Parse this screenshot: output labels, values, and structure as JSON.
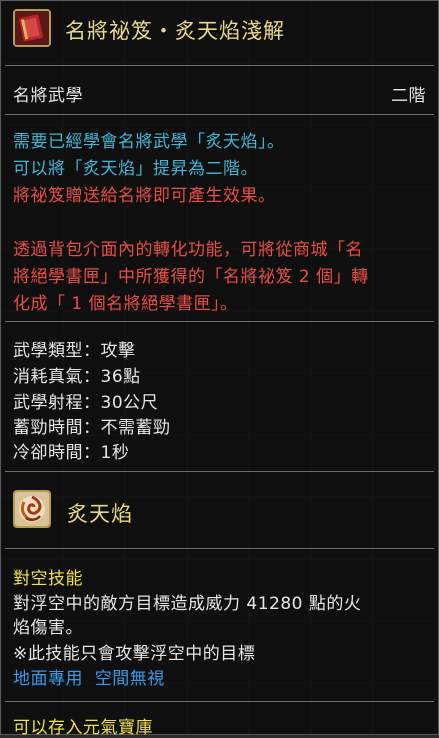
{
  "book": {
    "icon": "red-book-icon",
    "title": "名將祕笈・炙天焰淺解",
    "category": "名將武學",
    "grade": "二階",
    "desc_cyan": [
      "需要已經學會名將武學「炙天焰」。",
      "可以將「炙天焰」提昇為二階。"
    ],
    "desc_red": [
      "將祕笈贈送給名將即可產生效果。",
      "透過背包介面內的轉化功能，可將從商城「名",
      "將絕學書匣」中所獲得的「名將祕笈 2 個」轉",
      "化成「 1 個名將絕學書匣」。"
    ]
  },
  "stats": [
    {
      "label": "武學類型",
      "value": "攻擊"
    },
    {
      "label": "消耗真氣",
      "value": "36點"
    },
    {
      "label": "武學射程",
      "value": "30公尺"
    },
    {
      "label": "蓄勁時間",
      "value": "不需蓄勁"
    },
    {
      "label": "冷卻時間",
      "value": "1秒"
    }
  ],
  "skill": {
    "icon": "flame-swirl-icon",
    "title": "炙天焰",
    "type": "對空技能",
    "desc": [
      "對浮空中的敵方目標造成威力 41280 點的火",
      "焰傷害。",
      "※此技能只會攻擊浮空中的目標"
    ],
    "tags": "地面專用  空間無視"
  },
  "footer": "可以存入元氣寶庫",
  "colors": {
    "title": "#e8d98a",
    "cyan": "#3fb9d6",
    "red": "#ea4d45",
    "yellow": "#f0e04a",
    "blue": "#3a9ae8"
  }
}
